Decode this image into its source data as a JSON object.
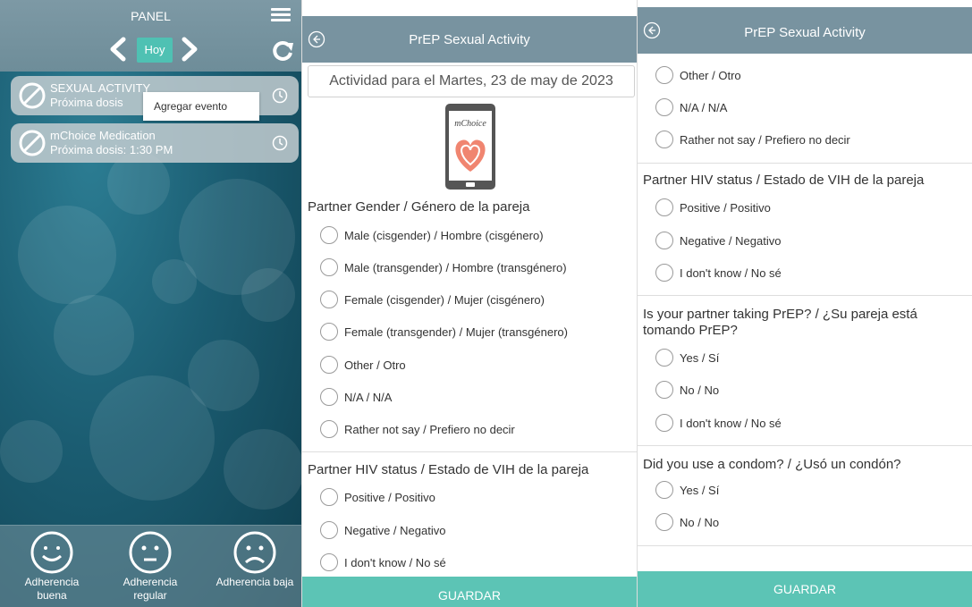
{
  "panel1": {
    "title": "PANEL",
    "today_label": "Hoy",
    "events": [
      {
        "title": "SEXUAL ACTIVITY",
        "subtitle": "Próxima dosis"
      },
      {
        "title": "mChoice Medication",
        "subtitle": "Próxima dosis: 1:30 PM"
      }
    ],
    "tooltip": "Agregar evento",
    "adherence": [
      {
        "label": "Adherencia buena",
        "icon": "smile-face-icon"
      },
      {
        "label": "Adherencia regular",
        "icon": "neutral-face-icon"
      },
      {
        "label": "Adherencia baja",
        "icon": "sad-face-icon"
      }
    ]
  },
  "form": {
    "title": "PrEP Sexual Activity",
    "date_label": "Actividad para el Martes, 23 de may de 2023",
    "logo_text": "mChoice",
    "save_label": "GUARDAR"
  },
  "questions": {
    "gender": {
      "title": "Partner Gender / Género de la pareja",
      "options": [
        "Male (cisgender) / Hombre (cisgénero)",
        "Male (transgender) / Hombre (transgénero)",
        "Female (cisgender) / Mujer (cisgénero)",
        "Female (transgender) / Mujer (transgénero)",
        "Other / Otro",
        "N/A / N/A",
        "Rather not say / Prefiero no decir"
      ]
    },
    "hiv": {
      "title": "Partner HIV status / Estado de VIH de la pareja",
      "options": [
        "Positive / Positivo",
        "Negative / Negativo",
        "I don't know / No sé"
      ]
    },
    "prep": {
      "title": "Is your partner taking PrEP? / ¿Su pareja está tomando PrEP?",
      "options": [
        "Yes / Sí",
        "No / No",
        "I don't know / No sé"
      ]
    },
    "condom": {
      "title": "Did you use a condom? / ¿Usó un condón?",
      "options": [
        "Yes / Sí",
        "No / No"
      ]
    }
  },
  "colors": {
    "header": "#7893a0",
    "accent": "#5cc4b5",
    "today": "#4fc1b3",
    "panel_bg": "#1b5d72"
  }
}
